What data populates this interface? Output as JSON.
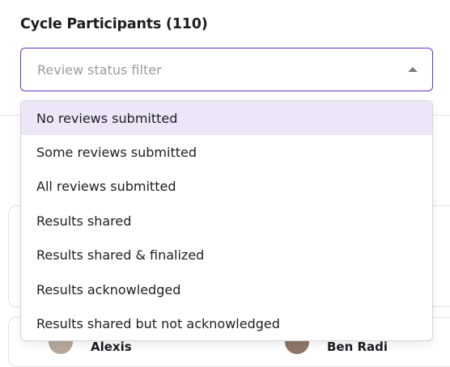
{
  "panel": {
    "title": "Cycle Participants (110)"
  },
  "filter": {
    "placeholder": "Review status filter",
    "caret_icon": "caret-up-icon",
    "accent_color": "#6a2fd1",
    "highlight_color": "#ece6f8",
    "options": [
      {
        "label": "No reviews submitted",
        "highlighted": true
      },
      {
        "label": "Some reviews submitted",
        "highlighted": false
      },
      {
        "label": "All reviews submitted",
        "highlighted": false
      },
      {
        "label": "Results shared",
        "highlighted": false
      },
      {
        "label": "Results shared & finalized",
        "highlighted": false
      },
      {
        "label": "Results acknowledged",
        "highlighted": false
      },
      {
        "label": "Results shared but not acknowledged",
        "highlighted": false
      }
    ]
  },
  "background_cards": {
    "names": [
      "Alexis",
      "Ben Radi"
    ]
  }
}
